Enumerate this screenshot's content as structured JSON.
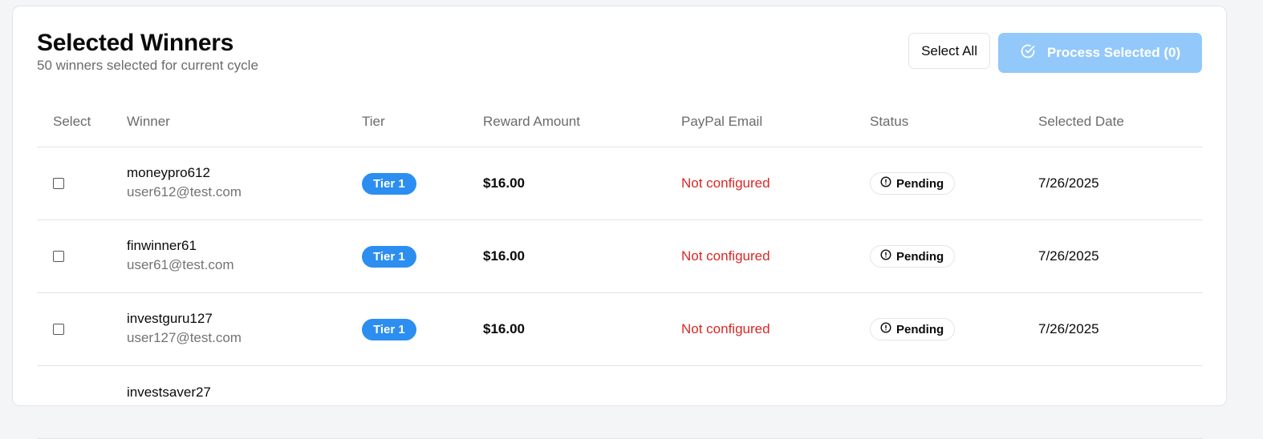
{
  "header": {
    "title": "Selected Winners",
    "subtitle": "50 winners selected for current cycle",
    "select_all_label": "Select All",
    "process_label": "Process Selected (0)"
  },
  "table": {
    "columns": [
      "Select",
      "Winner",
      "Tier",
      "Reward Amount",
      "PayPal Email",
      "Status",
      "Selected Date"
    ],
    "rows": [
      {
        "username": "moneypro612",
        "email": "user612@test.com",
        "tier": "Tier 1",
        "amount": "$16.00",
        "paypal": "Not configured",
        "status": "Pending",
        "date": "7/26/2025"
      },
      {
        "username": "finwinner61",
        "email": "user61@test.com",
        "tier": "Tier 1",
        "amount": "$16.00",
        "paypal": "Not configured",
        "status": "Pending",
        "date": "7/26/2025"
      },
      {
        "username": "investguru127",
        "email": "user127@test.com",
        "tier": "Tier 1",
        "amount": "$16.00",
        "paypal": "Not configured",
        "status": "Pending",
        "date": "7/26/2025"
      },
      {
        "username": "investsaver27",
        "email": "",
        "tier": "",
        "amount": "",
        "paypal": "",
        "status": "",
        "date": ""
      }
    ]
  },
  "colors": {
    "accent": "#2b8ef0",
    "primary_disabled": "#93c8fa",
    "error": "#dc2626"
  },
  "icons": {
    "process": "check-circle-icon",
    "status": "alert-circle-icon"
  }
}
